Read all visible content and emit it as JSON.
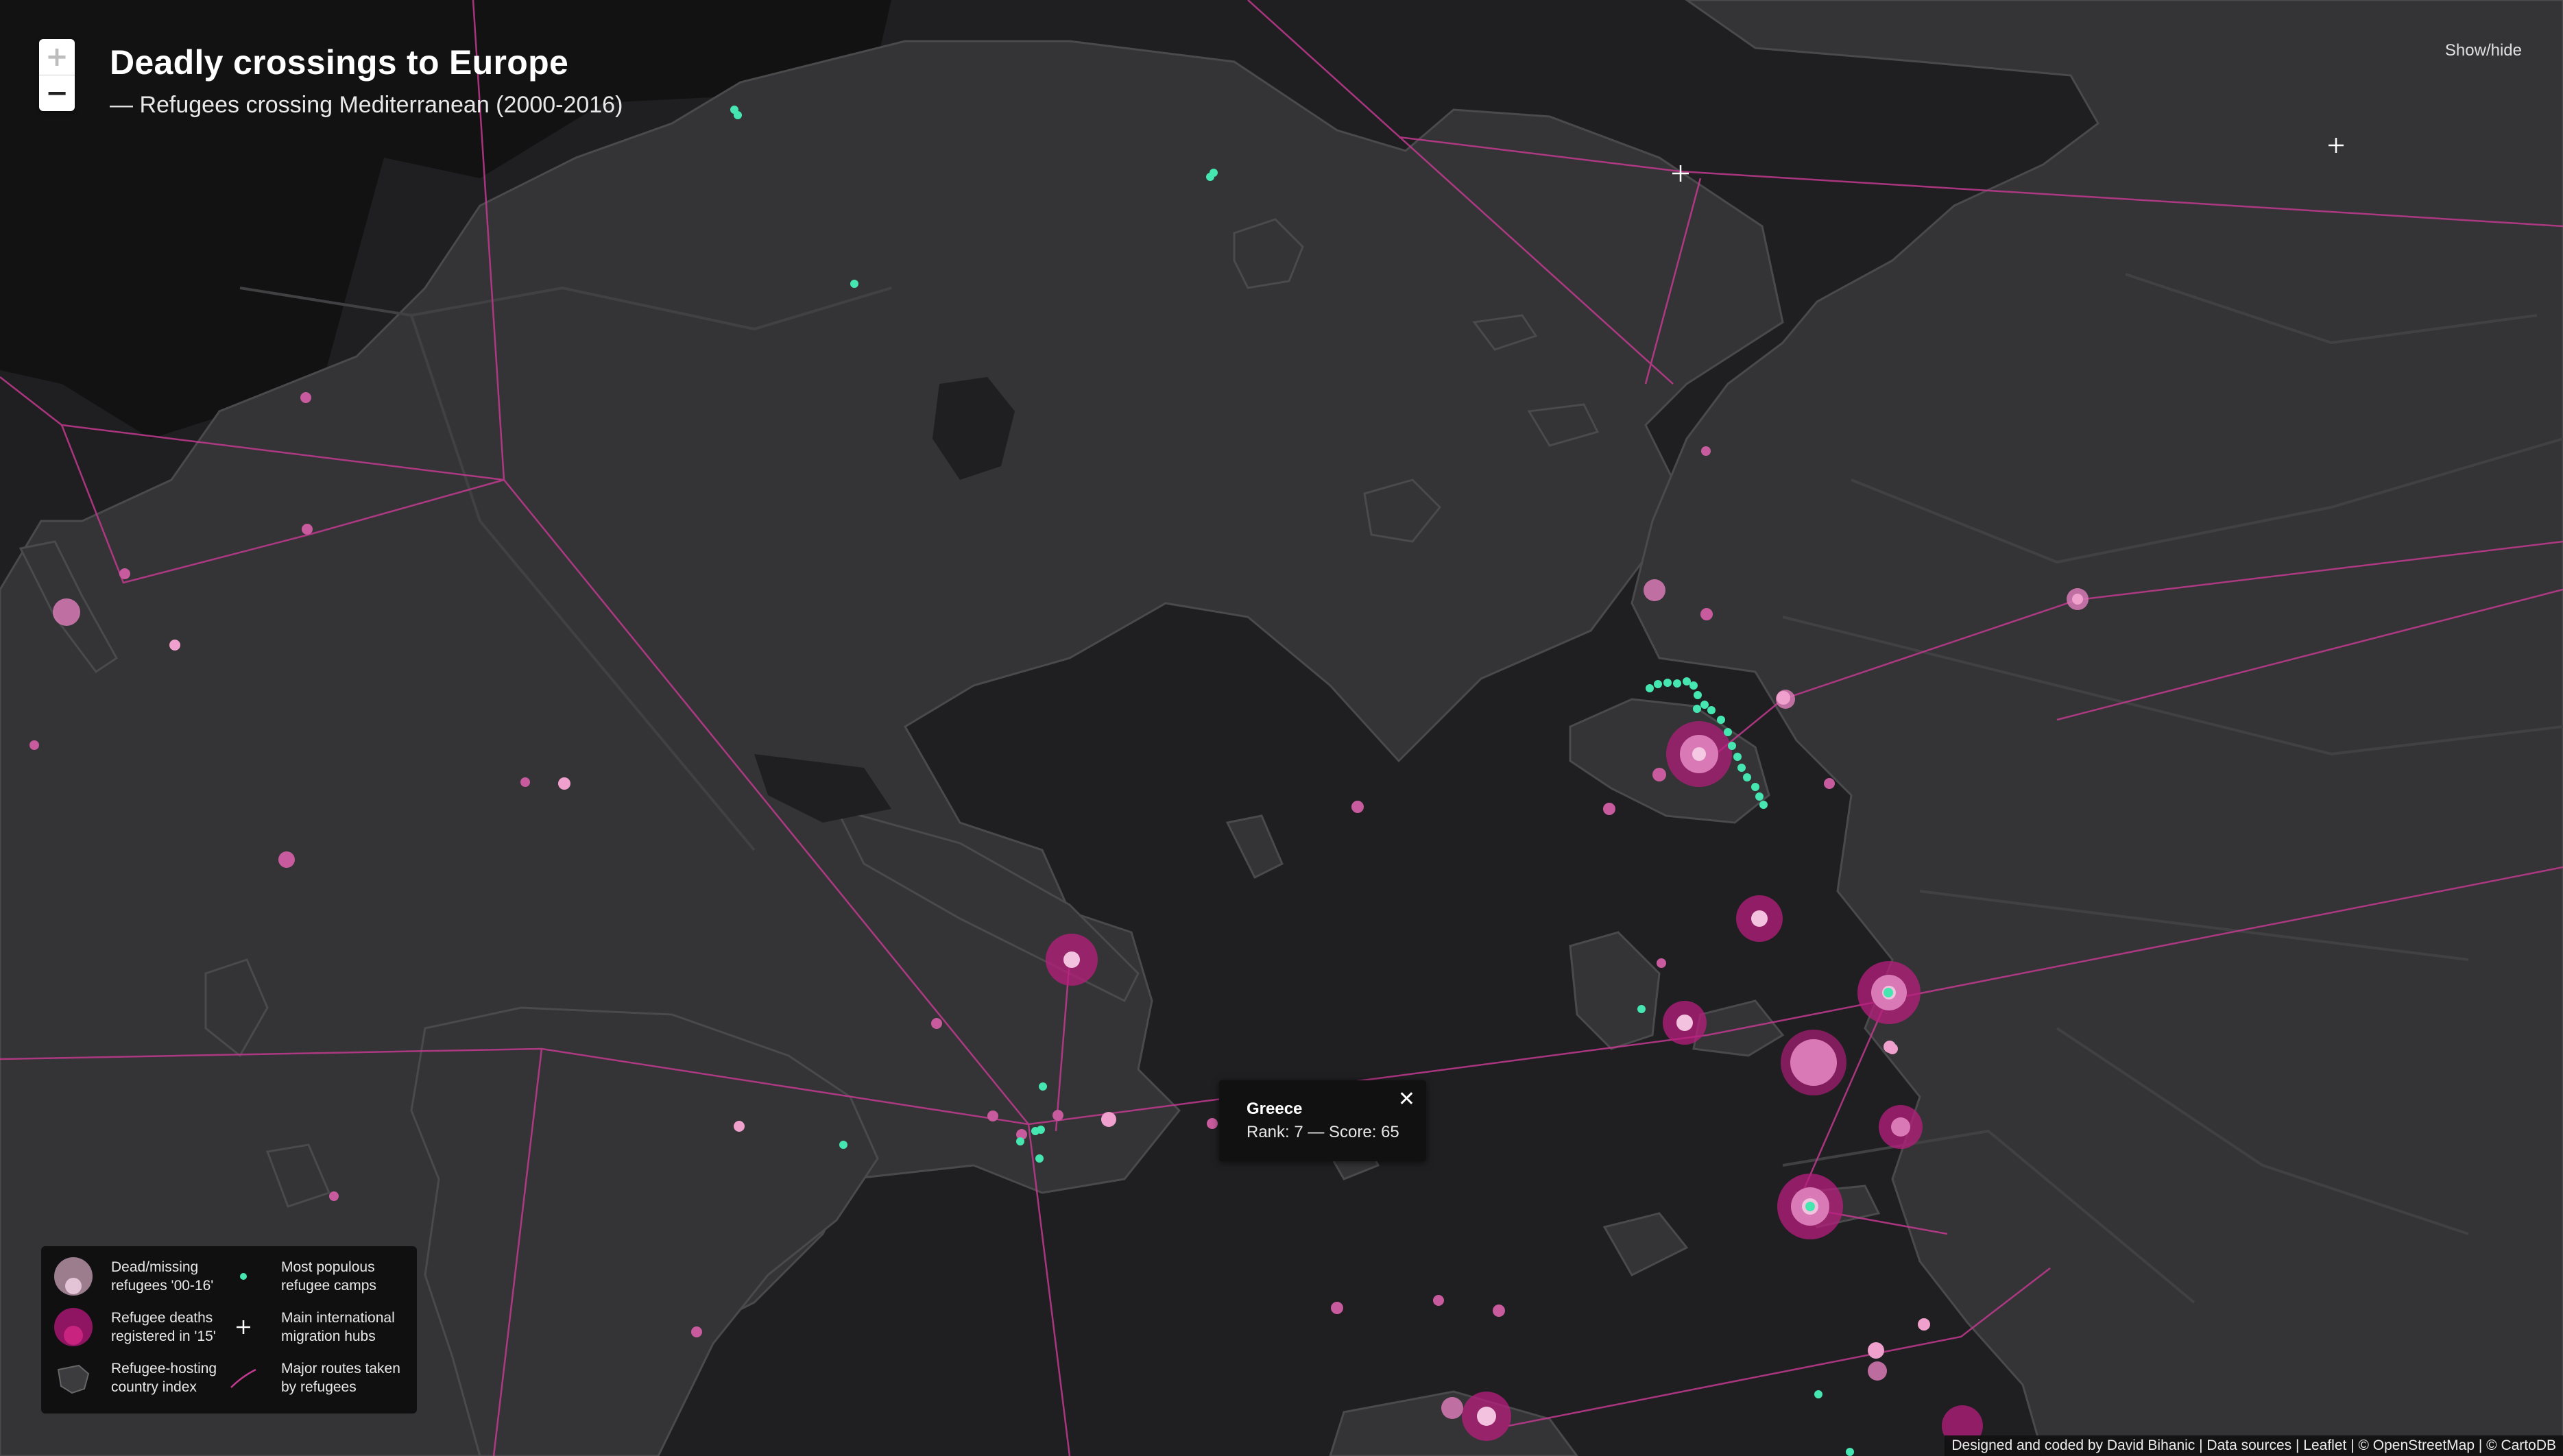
{
  "title": "Deadly crossings to Europe",
  "subtitle": "— Refugees crossing Mediterranean (2000-2016)",
  "controls": {
    "zoom_in": "+",
    "zoom_out": "−",
    "show_hide": "Show/hide"
  },
  "popup": {
    "country": "Greece",
    "detail": "Rank: 7 — Score: 65",
    "close": "✕"
  },
  "legend": [
    {
      "key": "dead_missing",
      "text": "Dead/missing\nrefugees '00-16'"
    },
    {
      "key": "deaths_2015",
      "text": "Refugee deaths\nregistered in '15'"
    },
    {
      "key": "hosting_index",
      "text": "Refugee-hosting\ncountry index"
    },
    {
      "key": "camps",
      "text": "Most populous\nrefugee camps"
    },
    {
      "key": "hubs",
      "text": "Main international\nmigration hubs"
    },
    {
      "key": "routes",
      "text": "Major routes taken\nby refugees"
    }
  ],
  "attribution": {
    "credit": "Designed and coded by David Bihanic",
    "links": [
      "Data sources",
      "Leaflet",
      "© OpenStreetMap",
      "© CartoDB"
    ],
    "separator": " | "
  },
  "colors": {
    "sea": "#1f1f21",
    "land": "#343436",
    "land_outside": "#121213",
    "route": "#c23a8f",
    "dead_missing": "#d97ab6",
    "deaths_2015": "#b81d7e",
    "camp": "#46e6b0",
    "hub": "#ffffff"
  },
  "icons": {
    "zoom_in": "plus-icon",
    "zoom_out": "minus-icon",
    "popup_close": "close-icon",
    "hub_marker": "plus-marker-icon",
    "route_line": "route-line-icon",
    "hosting_index": "land-shape-icon"
  }
}
